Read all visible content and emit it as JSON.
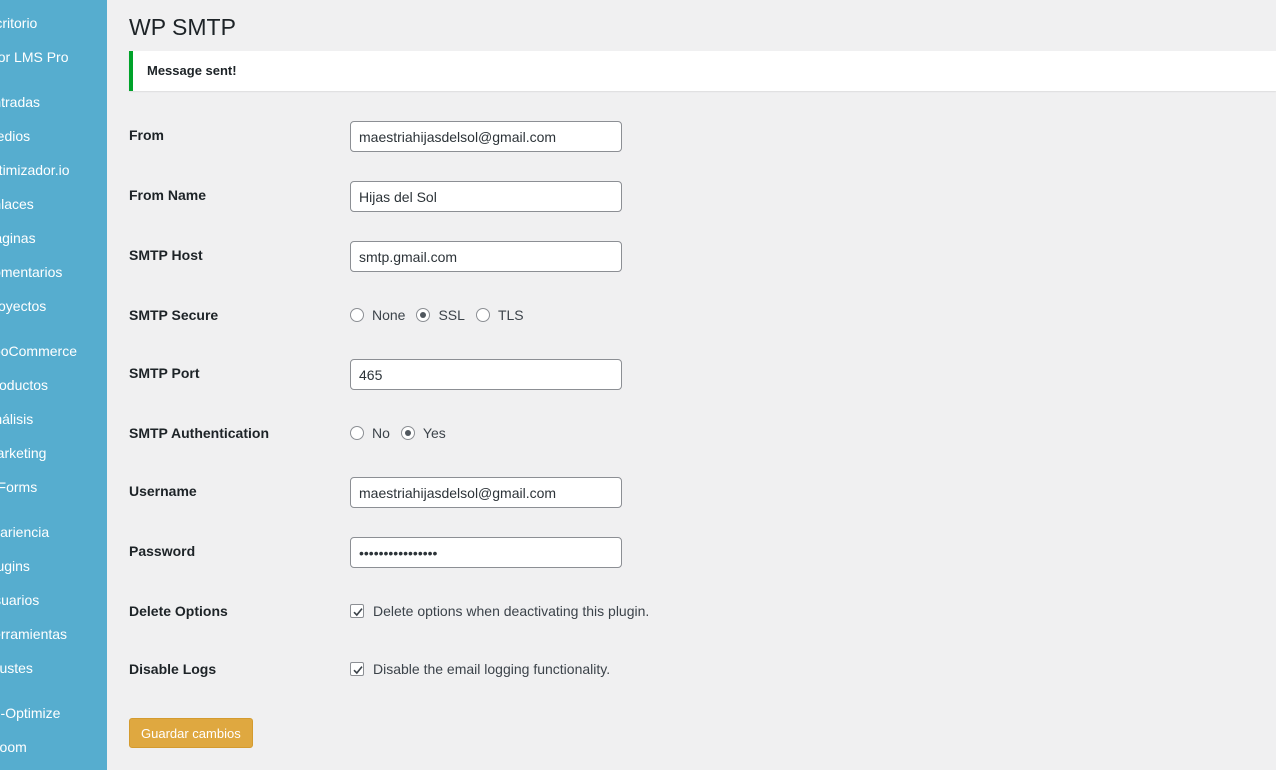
{
  "sidebar": {
    "items": [
      {
        "label": "Escritorio"
      },
      {
        "label": "Tutor LMS Pro"
      },
      {
        "label": "Entradas"
      },
      {
        "label": "Medios"
      },
      {
        "label": "Optimizador.io"
      },
      {
        "label": "Enlaces"
      },
      {
        "label": "Páginas"
      },
      {
        "label": "Comentarios"
      },
      {
        "label": "Proyectos"
      },
      {
        "label": "WooCommerce"
      },
      {
        "label": "Productos"
      },
      {
        "label": "Análisis"
      },
      {
        "label": "Marketing"
      },
      {
        "label": "WPForms"
      },
      {
        "label": "Apariencia"
      },
      {
        "label": "Plugins"
      },
      {
        "label": "Usuarios"
      },
      {
        "label": "Herramientas"
      },
      {
        "label": "Ajustes"
      },
      {
        "label": "WP-Optimize"
      },
      {
        "label": "Zoom"
      }
    ]
  },
  "page": {
    "title": "WP SMTP",
    "notice": "Message sent!"
  },
  "form": {
    "from": {
      "label": "From",
      "value": "maestriahijasdelsol@gmail.com"
    },
    "from_name": {
      "label": "From Name",
      "value": "Hijas del Sol"
    },
    "smtp_host": {
      "label": "SMTP Host",
      "value": "smtp.gmail.com"
    },
    "smtp_secure": {
      "label": "SMTP Secure",
      "options": [
        "None",
        "SSL",
        "TLS"
      ],
      "selected": "SSL"
    },
    "smtp_port": {
      "label": "SMTP Port",
      "value": "465"
    },
    "smtp_auth": {
      "label": "SMTP Authentication",
      "options": [
        "No",
        "Yes"
      ],
      "selected": "Yes"
    },
    "username": {
      "label": "Username",
      "value": "maestriahijasdelsol@gmail.com"
    },
    "password": {
      "label": "Password",
      "value": "••••••••••••••••"
    },
    "delete_options": {
      "label": "Delete Options",
      "checkbox_label": "Delete options when deactivating this plugin.",
      "checked": true
    },
    "disable_logs": {
      "label": "Disable Logs",
      "checkbox_label": "Disable the email logging functionality.",
      "checked": true
    },
    "save_label": "Guardar cambios"
  },
  "colors": {
    "sidebar_bg": "#56adcf",
    "notice_success": "#00a32a",
    "primary_button": "#dfa840"
  }
}
